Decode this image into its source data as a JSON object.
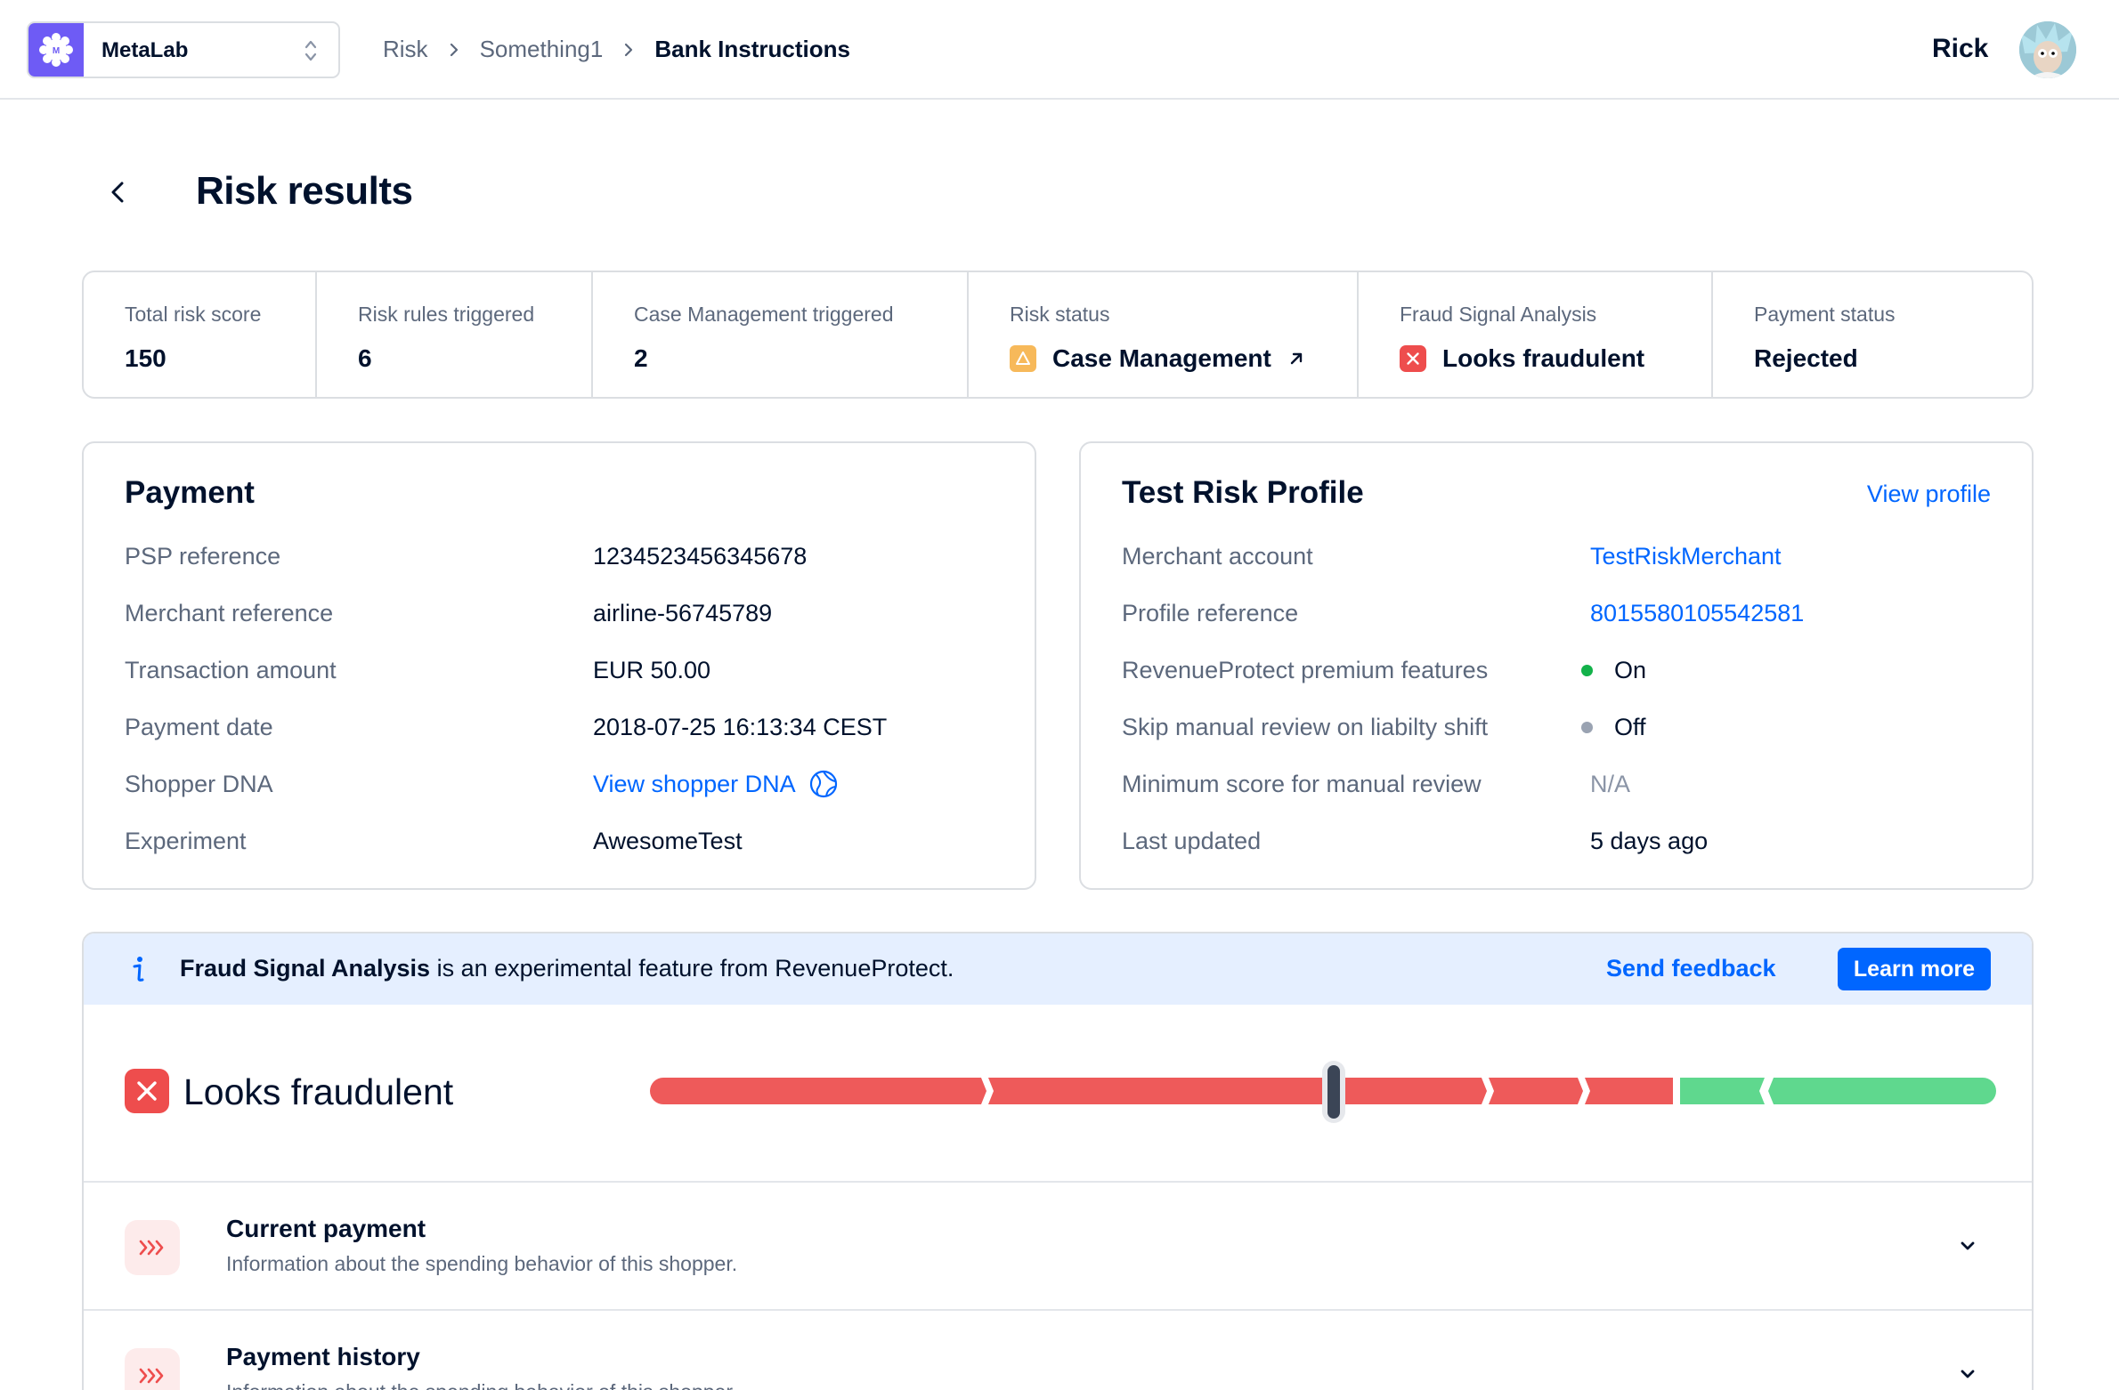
{
  "header": {
    "account_name": "MetaLab",
    "account_logo_letter": "M",
    "breadcrumbs": [
      "Risk",
      "Something1",
      "Bank Instructions"
    ],
    "user_name": "Rick"
  },
  "page": {
    "title": "Risk results"
  },
  "summary": [
    {
      "label": "Total risk score",
      "value": "150"
    },
    {
      "label": "Risk rules triggered",
      "value": "6"
    },
    {
      "label": "Case Management triggered",
      "value": "2"
    },
    {
      "label": "Risk status",
      "value": "Case Management",
      "icon": "warning-icon"
    },
    {
      "label": "Fraud Signal Analysis",
      "value": "Looks fraudulent",
      "icon": "error-icon"
    },
    {
      "label": "Payment status",
      "value": "Rejected"
    }
  ],
  "payment": {
    "title": "Payment",
    "rows": [
      {
        "label": "PSP reference",
        "value": "1234523456345678"
      },
      {
        "label": "Merchant reference",
        "value": "airline-56745789"
      },
      {
        "label": "Transaction amount",
        "value": "EUR 50.00"
      },
      {
        "label": "Payment date",
        "value": "2018-07-25 16:13:34 CEST"
      },
      {
        "label": "Shopper DNA",
        "value": "View shopper DNA"
      },
      {
        "label": "Experiment",
        "value": "AwesomeTest"
      }
    ]
  },
  "profile": {
    "title": "Test Risk Profile",
    "link": "View profile",
    "rows": [
      {
        "label": "Merchant account",
        "value": "TestRiskMerchant"
      },
      {
        "label": "Profile reference",
        "value": "8015580105542581"
      },
      {
        "label": "RevenueProtect premium features",
        "value": "On"
      },
      {
        "label": "Skip manual review on liabilty shift",
        "value": "Off"
      },
      {
        "label": "Minimum score for manual review",
        "value": "N/A"
      },
      {
        "label": "Last updated",
        "value": "5 days ago"
      }
    ]
  },
  "fraud": {
    "banner_bold": "Fraud Signal Analysis",
    "banner_text": " is an experimental feature from RevenueProtect.",
    "feedback": "Send feedback",
    "learn_more": "Learn more",
    "verdict": "Looks fraudulent",
    "colors": {
      "fraud": "#ee5a5a",
      "safe": "#5fd88e"
    },
    "sections": [
      {
        "title": "Current payment",
        "subtitle": "Information about the spending behavior of this shopper."
      },
      {
        "title": "Payment history",
        "subtitle": "Information about the spending behavior of this shopper."
      }
    ]
  }
}
